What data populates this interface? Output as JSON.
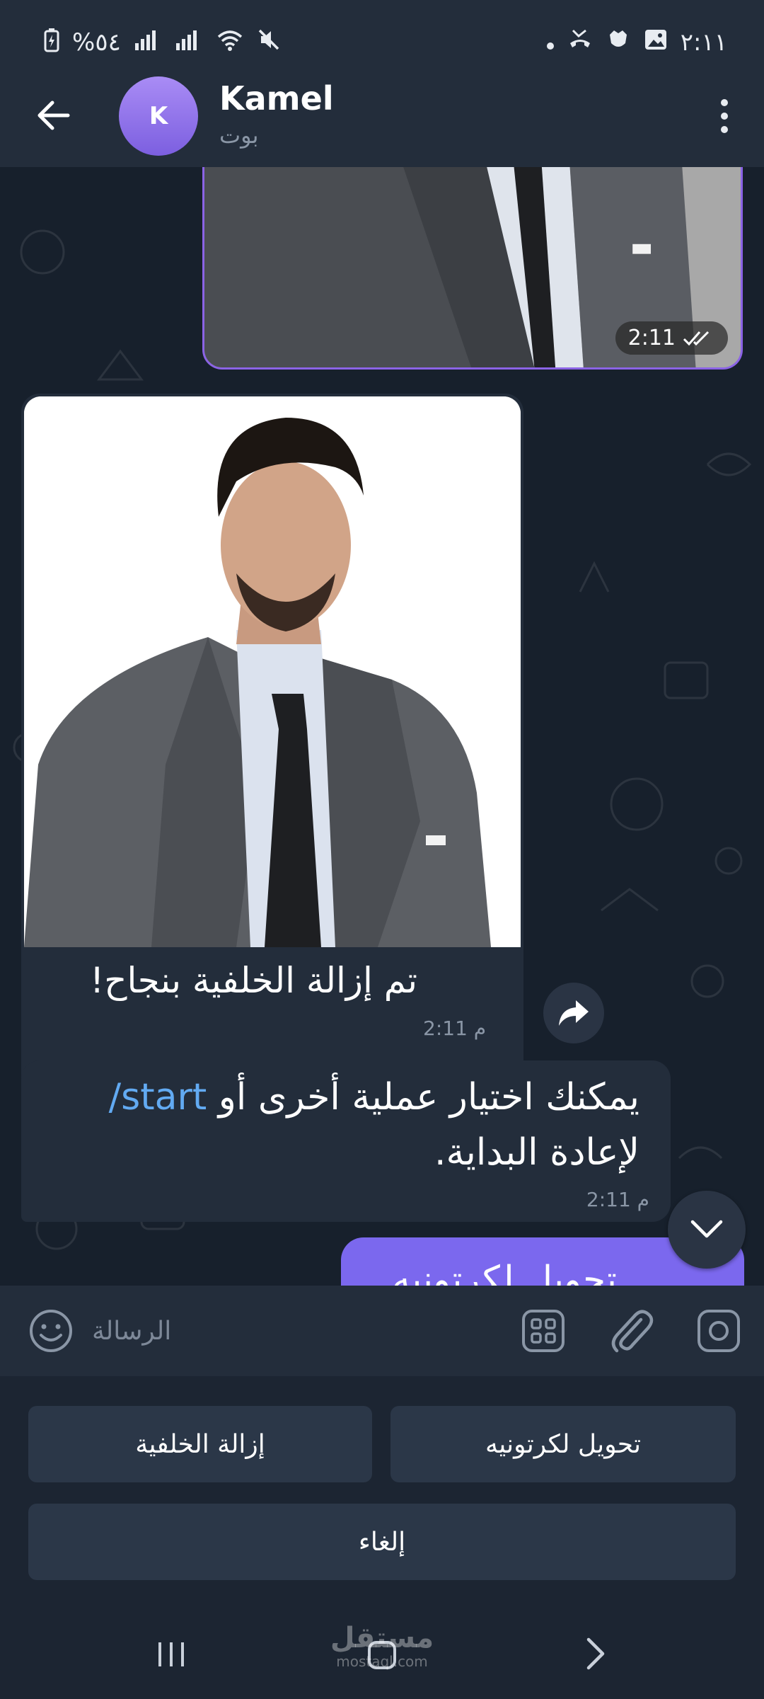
{
  "status_bar": {
    "time": "٢:١١",
    "battery": "%٥٤"
  },
  "header": {
    "avatar_letter": "K",
    "chat_name": "Kamel",
    "chat_subtitle": "بوت"
  },
  "messages": {
    "outgoing_photo_time": "2:11",
    "incoming_photo_caption": "تم إزالة الخلفية بنجاح!",
    "incoming_photo_time": "2:11 م",
    "incoming_text_line1_prefix": "يمكنك اختيار عملية أخرى أو ",
    "incoming_text_command": "/start",
    "incoming_text_line2": "لإعادة البداية.",
    "incoming_text_time": "2:11 م",
    "outgoing_partial_text": "تحويل لكرتونيه"
  },
  "composer": {
    "placeholder": "الرسالة"
  },
  "keyboard": {
    "button_cartoon": "تحويل لكرتونيه",
    "button_remove_bg": "إزالة الخلفية",
    "button_cancel": "إلغاء"
  },
  "watermark": {
    "main": "مستقل",
    "sub": "mostaql.com"
  },
  "colors": {
    "accent": "#7b68ee",
    "link": "#62aaf2",
    "bubble_in": "#232d3b",
    "background": "#17202c"
  }
}
